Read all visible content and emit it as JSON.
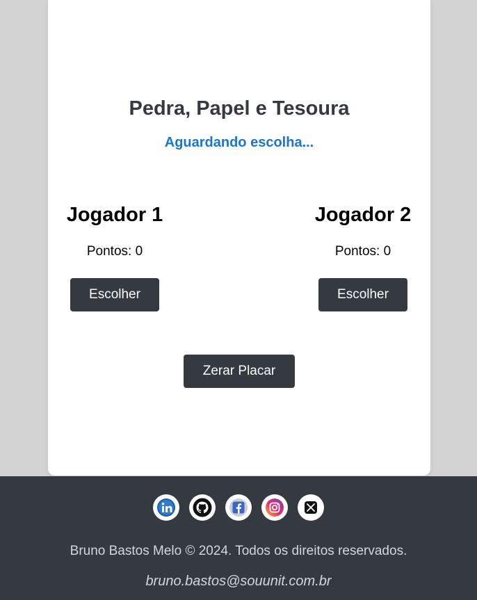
{
  "game": {
    "title": "Pedra, Papel e Tesoura",
    "status": "Aguardando escolha...",
    "reset_label": "Zerar Placar"
  },
  "players": [
    {
      "name": "Jogador 1",
      "score_text": "Pontos: 0",
      "score": 0,
      "choose_label": "Escolher"
    },
    {
      "name": "Jogador 2",
      "score_text": "Pontos: 0",
      "score": 0,
      "choose_label": "Escolher"
    }
  ],
  "footer": {
    "socials": [
      {
        "icon": "linkedin-icon",
        "color": "#0a66c2"
      },
      {
        "icon": "github-icon",
        "color": "#000000"
      },
      {
        "icon": "facebook-icon",
        "color": "#1877f2"
      },
      {
        "icon": "instagram-icon",
        "color": "#e1306c"
      },
      {
        "icon": "x-twitter-icon",
        "color": "#000000"
      }
    ],
    "copyright": "Bruno Bastos Melo © 2024. Todos os direitos reservados.",
    "email": "bruno.bastos@souunit.com.br"
  },
  "colors": {
    "page_bg": "#d3d3d3",
    "card_bg": "#ffffff",
    "dark": "#343a40",
    "status_blue": "#1976d2"
  }
}
